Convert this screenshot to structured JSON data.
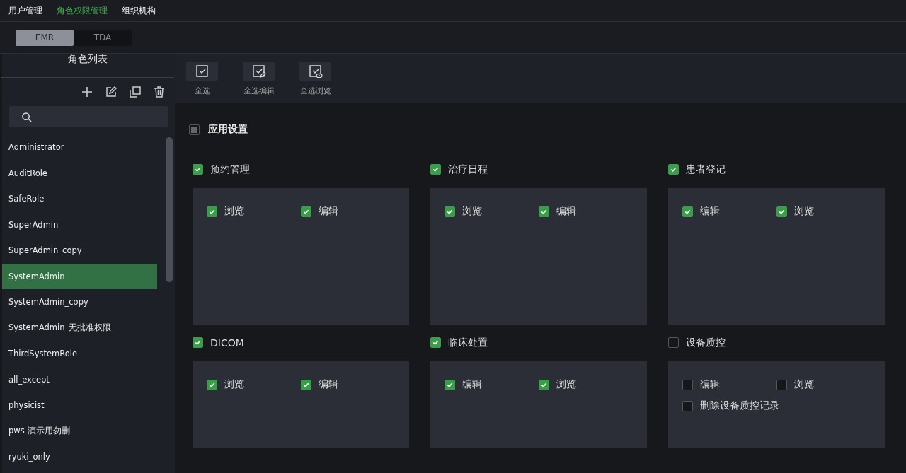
{
  "nav": [
    {
      "label": "用户管理",
      "selected": false
    },
    {
      "label": "角色权限管理",
      "selected": true
    },
    {
      "label": "组织机构",
      "selected": false
    }
  ],
  "subtabs": [
    {
      "label": "EMR",
      "selected": true
    },
    {
      "label": "TDA",
      "selected": false
    }
  ],
  "sidebar": {
    "title": "角色列表",
    "items": [
      {
        "label": "Administrator",
        "selected": false
      },
      {
        "label": "AuditRole",
        "selected": false
      },
      {
        "label": "SafeRole",
        "selected": false
      },
      {
        "label": "SuperAdmin",
        "selected": false
      },
      {
        "label": "SuperAdmin_copy",
        "selected": false
      },
      {
        "label": "SystemAdmin",
        "selected": true
      },
      {
        "label": "SystemAdmin_copy",
        "selected": false
      },
      {
        "label": "SystemAdmin_无批准权限",
        "selected": false
      },
      {
        "label": "ThirdSystemRole",
        "selected": false
      },
      {
        "label": "all_except",
        "selected": false
      },
      {
        "label": "physicist",
        "selected": false
      },
      {
        "label": "pws-演示用勿删",
        "selected": false
      },
      {
        "label": "ryuki_only",
        "selected": false
      }
    ]
  },
  "toolbar": [
    {
      "kind": "select",
      "label": "全选"
    },
    {
      "kind": "edit",
      "label": "全选编辑"
    },
    {
      "kind": "view",
      "label": "全选浏览"
    }
  ],
  "group": {
    "label": "应用设置",
    "checked": false,
    "indeterminate": true
  },
  "sections": [
    {
      "label": "预约管理",
      "checked": true,
      "options": [
        {
          "label": "浏览",
          "checked": true
        },
        {
          "label": "编辑",
          "checked": true
        }
      ]
    },
    {
      "label": "治疗日程",
      "checked": true,
      "options": [
        {
          "label": "浏览",
          "checked": true
        },
        {
          "label": "编辑",
          "checked": true
        }
      ]
    },
    {
      "label": "患者登记",
      "checked": true,
      "options": [
        {
          "label": "编辑",
          "checked": true
        },
        {
          "label": "浏览",
          "checked": true
        }
      ]
    },
    {
      "label": "DICOM",
      "checked": true,
      "options": [
        {
          "label": "浏览",
          "checked": true
        },
        {
          "label": "编辑",
          "checked": true
        }
      ]
    },
    {
      "label": "临床处置",
      "checked": true,
      "options": [
        {
          "label": "编辑",
          "checked": true
        },
        {
          "label": "浏览",
          "checked": true
        }
      ]
    },
    {
      "label": "设备质控",
      "checked": false,
      "options": [
        {
          "label": "编辑",
          "checked": false
        },
        {
          "label": "浏览",
          "checked": false
        },
        {
          "label": "删除设备质控记录",
          "checked": false
        }
      ]
    }
  ]
}
